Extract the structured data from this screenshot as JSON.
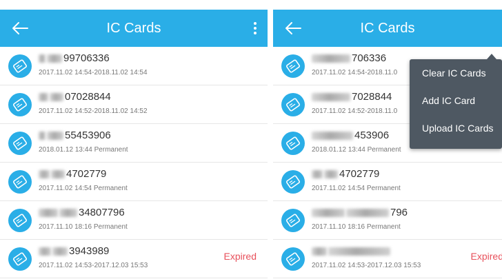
{
  "colors": {
    "primary": "#2aaee7",
    "expired": "#e8505b",
    "menu_background": "#4e5862"
  },
  "left_screen": {
    "appbar": {
      "title": "IC Cards",
      "back_icon": "arrow-left-icon",
      "more_icon": "more-vertical-icon"
    },
    "cards": [
      {
        "number": "99706336",
        "date": "2017.11.02 14:54-2018.11.02 14:54",
        "status": ""
      },
      {
        "number": "07028844",
        "date": "2017.11.02 14:52-2018.11.02 14:52",
        "status": ""
      },
      {
        "number": "55453906",
        "date": "2018.01.12 13:44  Permanent",
        "status": ""
      },
      {
        "number": "4702779",
        "date": "2017.11.02 14:54  Permanent",
        "status": ""
      },
      {
        "number": "34807796",
        "date": "2017.11.10 18:16  Permanent",
        "status": ""
      },
      {
        "number": "3943989",
        "date": "2017.11.02 14:53-2017.12.03 15:53",
        "status": "Expired"
      }
    ]
  },
  "right_screen": {
    "appbar": {
      "title": "IC Cards",
      "back_icon": "arrow-left-icon"
    },
    "cards": [
      {
        "number": "706336",
        "date": "2017.11.02 14:54-2018.11.0",
        "status": ""
      },
      {
        "number": "7028844",
        "date": "2017.11.02 14:52-2018.11.0",
        "status": ""
      },
      {
        "number": "453906",
        "date": "2018.01.12 13:44  Permanent",
        "status": ""
      },
      {
        "number": "4702779",
        "date": "2017.11.02 14:54  Permanent",
        "status": ""
      },
      {
        "number": "796",
        "date": "2017.11.10 18:16  Permanent",
        "status": ""
      },
      {
        "number": "",
        "date": "2017.11.02 14:53-2017.12.03 15:53",
        "status": "Expired"
      }
    ],
    "menu": {
      "items": [
        "Clear IC Cards",
        "Add IC Card",
        "Upload IC Cards"
      ]
    }
  }
}
